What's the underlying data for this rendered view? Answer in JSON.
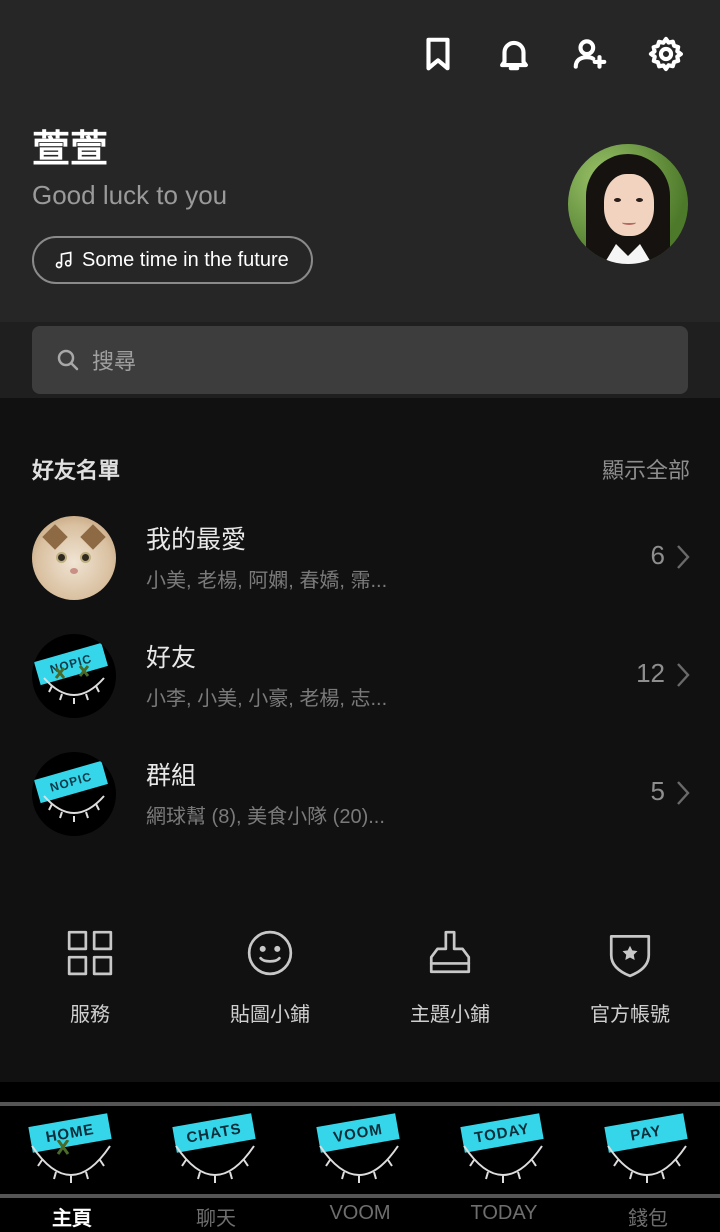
{
  "profile": {
    "name": "萱萱",
    "status": "Good luck to you",
    "music": "Some time in the future"
  },
  "search": {
    "placeholder": "搜尋"
  },
  "friends_section": {
    "title": "好友名單",
    "show_all": "顯示全部",
    "rows": [
      {
        "title": "我的最愛",
        "subtitle": "小美, 老楊, 阿嫻, 春嬌, 霈...",
        "count": "6"
      },
      {
        "title": "好友",
        "subtitle": "小李, 小美, 小豪, 老楊, 志...",
        "count": "12"
      },
      {
        "title": "群組",
        "subtitle": "網球幫 (8), 美食小隊 (20)...",
        "count": "5"
      }
    ]
  },
  "shortcuts": [
    {
      "label": "服務",
      "icon": "grid-icon"
    },
    {
      "label": "貼圖小鋪",
      "icon": "smiley-icon"
    },
    {
      "label": "主題小鋪",
      "icon": "brush-icon"
    },
    {
      "label": "官方帳號",
      "icon": "shield-star-icon"
    }
  ],
  "nav": [
    {
      "badge": "HOME",
      "label": "主頁",
      "active": true
    },
    {
      "badge": "CHATS",
      "label": "聊天",
      "active": false
    },
    {
      "badge": "VOOM",
      "label": "VOOM",
      "active": false
    },
    {
      "badge": "TODAY",
      "label": "TODAY",
      "active": false
    },
    {
      "badge": "PAY",
      "label": "錢包",
      "active": false
    }
  ],
  "nopic_text": "NOPIC",
  "colors": {
    "accent": "#36d6ea",
    "background": "#111111",
    "header": "#262626"
  }
}
